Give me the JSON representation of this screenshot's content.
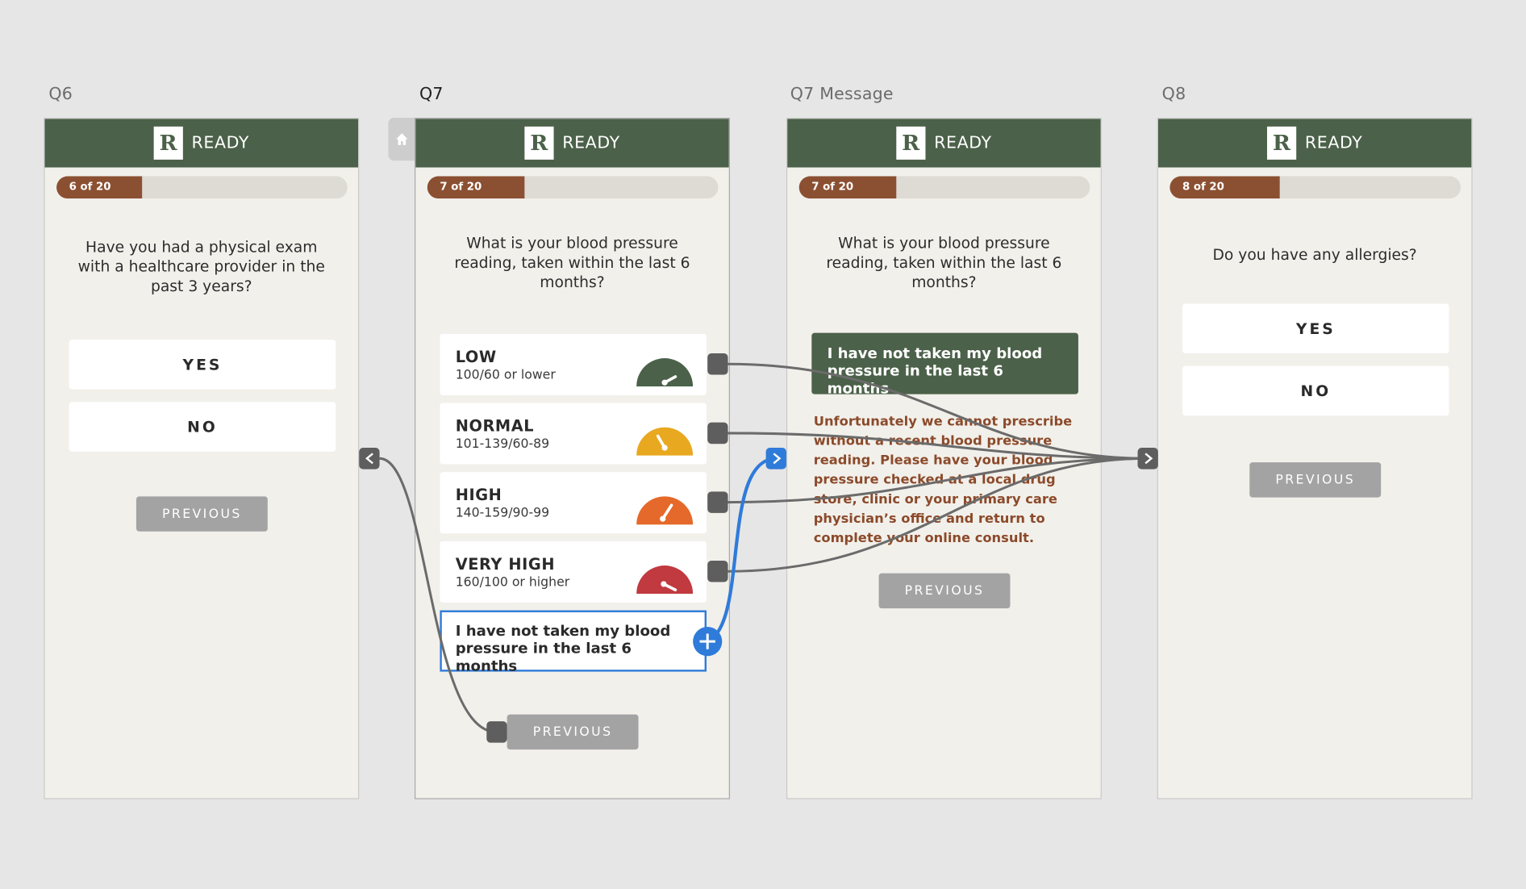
{
  "artboards": [
    {
      "label": "Q6"
    },
    {
      "label": "Q7"
    },
    {
      "label": "Q7 Message"
    },
    {
      "label": "Q8"
    }
  ],
  "brand": "READY",
  "q6": {
    "progress": "6 of 20",
    "progress_value": 0.3,
    "question": "Have you had a physical exam with a healthcare provider in the past 3 years?",
    "yes": "YES",
    "no": "NO",
    "previous": "PREVIOUS"
  },
  "q7": {
    "progress": "7 of 20",
    "progress_value": 0.35,
    "question": "What is your blood pressure reading, taken within the last 6 months?",
    "options": [
      {
        "title": "LOW",
        "range": "100/60 or lower",
        "color": "#4b6149"
      },
      {
        "title": "NORMAL",
        "range": "101-139/60-89",
        "color": "#e8a820"
      },
      {
        "title": "HIGH",
        "range": "140-159/90-99",
        "color": "#e5692a"
      },
      {
        "title": "VERY HIGH",
        "range": "160/100 or higher",
        "color": "#c03a3f"
      }
    ],
    "not_taken": "I have not taken my blood pressure in the last 6 months",
    "previous": "PREVIOUS"
  },
  "q7msg": {
    "progress": "7 of 20",
    "progress_value": 0.35,
    "question": "What is your blood pressure reading, taken within the last 6 months?",
    "selected": "I have not taken my blood pressure in the last 6 months",
    "message": "Unfortunately we cannot prescribe without a recent blood pressure reading.  Please have your blood pressure checked at a local drug store, clinic or your primary care physician’s office and return to complete your online consult.",
    "previous": "PREVIOUS"
  },
  "q8": {
    "progress": "8 of 20",
    "progress_value": 0.4,
    "question": "Do you have any allergies?",
    "yes": "YES",
    "no": "NO",
    "previous": "PREVIOUS"
  },
  "colors": {
    "header": "#4b6149",
    "progress": "#8b5032",
    "wire": "#6b6b6b",
    "link": "#2f7bd9"
  }
}
